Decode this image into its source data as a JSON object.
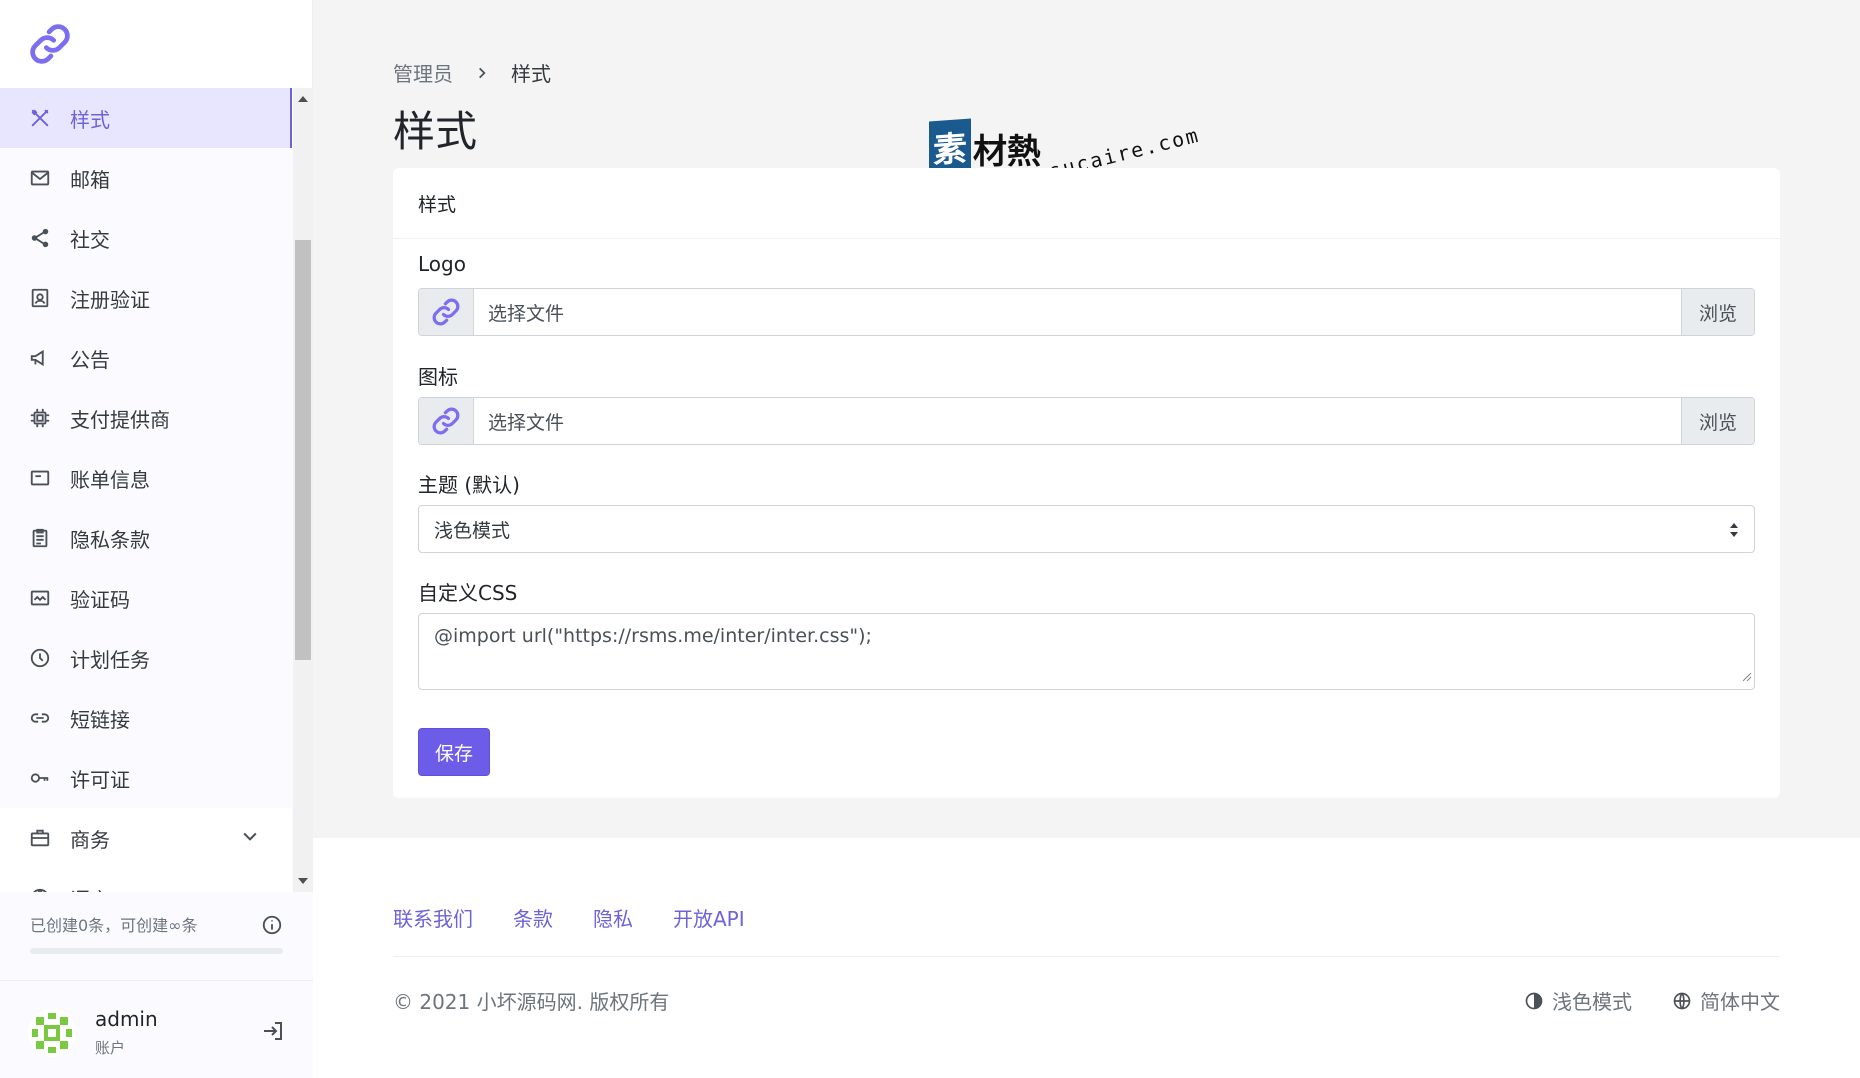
{
  "sidebar": {
    "items": [
      {
        "label": "样式",
        "icon": "tools-icon",
        "active": true
      },
      {
        "label": "邮箱",
        "icon": "mail-icon"
      },
      {
        "label": "社交",
        "icon": "share-icon"
      },
      {
        "label": "注册验证",
        "icon": "badge-icon"
      },
      {
        "label": "公告",
        "icon": "megaphone-icon"
      },
      {
        "label": "支付提供商",
        "icon": "cpu-icon"
      },
      {
        "label": "账单信息",
        "icon": "receipt-icon"
      },
      {
        "label": "隐私条款",
        "icon": "document-icon"
      },
      {
        "label": "验证码",
        "icon": "captcha-icon"
      },
      {
        "label": "计划任务",
        "icon": "clock-icon"
      },
      {
        "label": "短链接",
        "icon": "link-icon"
      },
      {
        "label": "许可证",
        "icon": "key-icon"
      },
      {
        "label": "商务",
        "icon": "briefcase-icon"
      },
      {
        "label": "语言",
        "icon": "globe-icon"
      }
    ],
    "quota_text": "已创建0条，可创建∞条",
    "user": {
      "name": "admin",
      "role": "账户"
    }
  },
  "breadcrumb": {
    "parent": "管理员",
    "current": "样式"
  },
  "page_title": "样式",
  "watermark": {
    "box": "素",
    "text": "材熱",
    "url": "sucaire.com"
  },
  "card": {
    "header": "样式",
    "logo": {
      "label": "Logo",
      "file_text": "选择文件",
      "browse": "浏览"
    },
    "favicon": {
      "label": "图标",
      "file_text": "选择文件",
      "browse": "浏览"
    },
    "theme": {
      "label": "主题 (默认)",
      "value": "浅色模式"
    },
    "css": {
      "label": "自定义CSS",
      "value": "@import url(\"https://rsms.me/inter/inter.css\");"
    },
    "save": "保存"
  },
  "footer": {
    "links": [
      "联系我们",
      "条款",
      "隐私",
      "开放API"
    ],
    "copyright": "© 2021 小坏源码网. 版权所有",
    "theme": "浅色模式",
    "language": "简体中文"
  },
  "colors": {
    "accent": "#6c5ce7",
    "link": "#6c63d9",
    "active_bg": "#e8e6ff"
  }
}
